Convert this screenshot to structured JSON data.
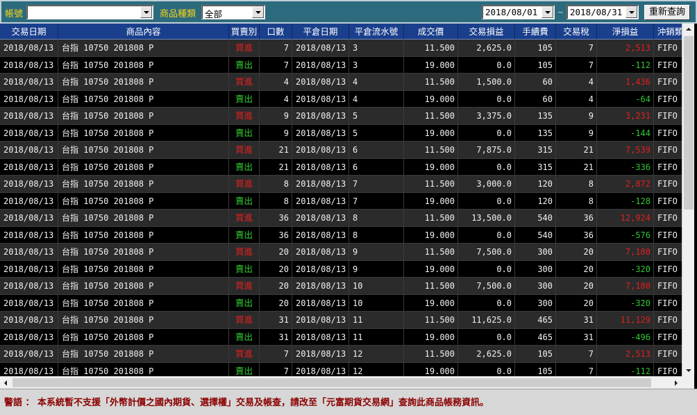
{
  "toolbar": {
    "account_label": "帳號",
    "account_value": "",
    "product_type_label": "商品種類",
    "product_type_value": "全部",
    "date_from": "2018/08/01",
    "date_sep": "~",
    "date_to": "2018/08/31",
    "requery_label": "重新查詢"
  },
  "table": {
    "headers": [
      "交易日期",
      "商品內容",
      "買賣別",
      "口數",
      "平倉日期",
      "平倉流水號",
      "成交價",
      "交易損益",
      "手續費",
      "交易稅",
      "淨損益",
      "沖銷類"
    ],
    "rows": [
      [
        "2018/08/13",
        "台指 10750 201808 P",
        "買進",
        "7",
        "2018/08/13",
        "3",
        "11.500",
        "2,625.0",
        "105",
        "7",
        "2,513",
        "FIFO"
      ],
      [
        "2018/08/13",
        "台指 10750 201808 P",
        "賣出",
        "7",
        "2018/08/13",
        "3",
        "19.000",
        "0.0",
        "105",
        "7",
        "-112",
        "FIFO"
      ],
      [
        "2018/08/13",
        "台指 10750 201808 P",
        "買進",
        "4",
        "2018/08/13",
        "4",
        "11.500",
        "1,500.0",
        "60",
        "4",
        "1,436",
        "FIFO"
      ],
      [
        "2018/08/13",
        "台指 10750 201808 P",
        "賣出",
        "4",
        "2018/08/13",
        "4",
        "19.000",
        "0.0",
        "60",
        "4",
        "-64",
        "FIFO"
      ],
      [
        "2018/08/13",
        "台指 10750 201808 P",
        "買進",
        "9",
        "2018/08/13",
        "5",
        "11.500",
        "3,375.0",
        "135",
        "9",
        "3,231",
        "FIFO"
      ],
      [
        "2018/08/13",
        "台指 10750 201808 P",
        "賣出",
        "9",
        "2018/08/13",
        "5",
        "19.000",
        "0.0",
        "135",
        "9",
        "-144",
        "FIFO"
      ],
      [
        "2018/08/13",
        "台指 10750 201808 P",
        "買進",
        "21",
        "2018/08/13",
        "6",
        "11.500",
        "7,875.0",
        "315",
        "21",
        "7,539",
        "FIFO"
      ],
      [
        "2018/08/13",
        "台指 10750 201808 P",
        "賣出",
        "21",
        "2018/08/13",
        "6",
        "19.000",
        "0.0",
        "315",
        "21",
        "-336",
        "FIFO"
      ],
      [
        "2018/08/13",
        "台指 10750 201808 P",
        "買進",
        "8",
        "2018/08/13",
        "7",
        "11.500",
        "3,000.0",
        "120",
        "8",
        "2,872",
        "FIFO"
      ],
      [
        "2018/08/13",
        "台指 10750 201808 P",
        "賣出",
        "8",
        "2018/08/13",
        "7",
        "19.000",
        "0.0",
        "120",
        "8",
        "-128",
        "FIFO"
      ],
      [
        "2018/08/13",
        "台指 10750 201808 P",
        "買進",
        "36",
        "2018/08/13",
        "8",
        "11.500",
        "13,500.0",
        "540",
        "36",
        "12,924",
        "FIFO"
      ],
      [
        "2018/08/13",
        "台指 10750 201808 P",
        "賣出",
        "36",
        "2018/08/13",
        "8",
        "19.000",
        "0.0",
        "540",
        "36",
        "-576",
        "FIFO"
      ],
      [
        "2018/08/13",
        "台指 10750 201808 P",
        "買進",
        "20",
        "2018/08/13",
        "9",
        "11.500",
        "7,500.0",
        "300",
        "20",
        "7,180",
        "FIFO"
      ],
      [
        "2018/08/13",
        "台指 10750 201808 P",
        "賣出",
        "20",
        "2018/08/13",
        "9",
        "19.000",
        "0.0",
        "300",
        "20",
        "-320",
        "FIFO"
      ],
      [
        "2018/08/13",
        "台指 10750 201808 P",
        "買進",
        "20",
        "2018/08/13",
        "10",
        "11.500",
        "7,500.0",
        "300",
        "20",
        "7,180",
        "FIFO"
      ],
      [
        "2018/08/13",
        "台指 10750 201808 P",
        "賣出",
        "20",
        "2018/08/13",
        "10",
        "19.000",
        "0.0",
        "300",
        "20",
        "-320",
        "FIFO"
      ],
      [
        "2018/08/13",
        "台指 10750 201808 P",
        "買進",
        "31",
        "2018/08/13",
        "11",
        "11.500",
        "11,625.0",
        "465",
        "31",
        "11,129",
        "FIFO"
      ],
      [
        "2018/08/13",
        "台指 10750 201808 P",
        "賣出",
        "31",
        "2018/08/13",
        "11",
        "19.000",
        "0.0",
        "465",
        "31",
        "-496",
        "FIFO"
      ],
      [
        "2018/08/13",
        "台指 10750 201808 P",
        "買進",
        "7",
        "2018/08/13",
        "12",
        "11.500",
        "2,625.0",
        "105",
        "7",
        "2,513",
        "FIFO"
      ],
      [
        "2018/08/13",
        "台指 10750 201808 P",
        "賣出",
        "7",
        "2018/08/13",
        "12",
        "19.000",
        "0.0",
        "105",
        "7",
        "-112",
        "FIFO"
      ]
    ]
  },
  "footer": {
    "warning": "警語 ： 本系統暫不支援「外幣計價之國內期貨、選擇權」交易及帳查，請改至「元富期貨交易網」查詢此商品帳務資訊。"
  },
  "colors": {
    "toolbar_bg": "#2c6b7d",
    "label_yellow": "#f7d417",
    "header_bg": "#1a3f8c",
    "buy_red": "#e02020",
    "sell_green": "#32c832",
    "warning_text": "#8b0000"
  }
}
